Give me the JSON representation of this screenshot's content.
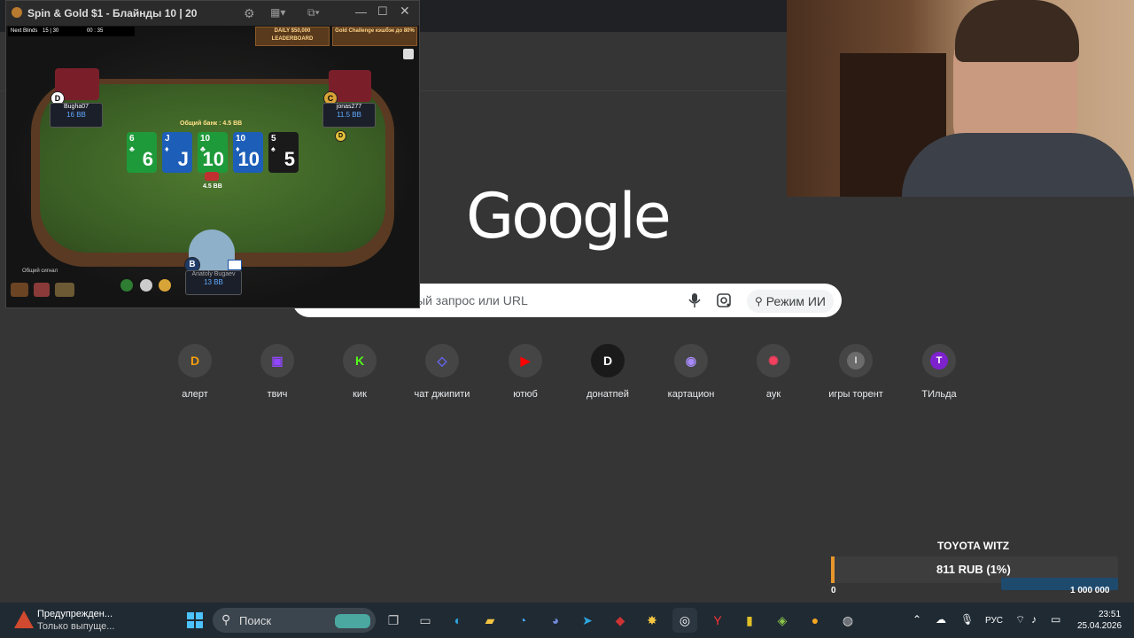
{
  "poker": {
    "window_title": "Spin & Gold $1 - Блайнды 10 | 20",
    "next_blinds_label": "Next Blinds",
    "next_blinds_value": "15 | 30",
    "timer": "00 : 35",
    "promo_left": "DAILY $50,000 LEADERBOARD",
    "promo_right": "Gold Challenge кэшбэк до 80%",
    "pot_label": "Общий банк : 4.5 BB",
    "pot_chips": "4.5 BB",
    "seat_left_name": "Bugha07",
    "seat_left_stack": "16 BB",
    "seat_right_name": "jonas277",
    "seat_right_stack": "11.5 BB",
    "seat_hero_name": "Anatoly Bugaev",
    "seat_hero_stack": "13 BB",
    "shared_signal": "Общий сигнал",
    "board_cards": [
      {
        "rank": "6",
        "suit": "♣",
        "color": "#1f9a3a"
      },
      {
        "rank": "J",
        "suit": "♦",
        "color": "#1d5fb8"
      },
      {
        "rank": "10",
        "suit": "♣",
        "color": "#1f9a3a"
      },
      {
        "rank": "10",
        "suit": "♦",
        "color": "#1d5fb8"
      },
      {
        "rank": "5",
        "suit": "♠",
        "color": "#1a1a1a"
      }
    ]
  },
  "google": {
    "logo_text": "Google",
    "search_placeholder": "ый запрос или URL",
    "ai_mode_label": "Режим ИИ"
  },
  "shortcuts": [
    {
      "label": "алерт",
      "glyph": "D",
      "color": "#f59e0b"
    },
    {
      "label": "твич",
      "glyph": "▣",
      "color": "#9146ff"
    },
    {
      "label": "кик",
      "glyph": "K",
      "color": "#53fc18"
    },
    {
      "label": "чат джипити",
      "glyph": "◇",
      "color": "#6366f1"
    },
    {
      "label": "ютюб",
      "glyph": "▶",
      "color": "#ff0000"
    },
    {
      "label": "донатпей",
      "glyph": "D",
      "color": "#111111"
    },
    {
      "label": "картацион",
      "glyph": "◉",
      "color": "#7c3aed"
    },
    {
      "label": "аук",
      "glyph": "✺",
      "color": "#e11d48"
    },
    {
      "label": "игры торент",
      "glyph": "I",
      "color": "#6b6b6b"
    },
    {
      "label": "ТИльда",
      "glyph": "T",
      "color": "#7e22ce"
    }
  ],
  "donation": {
    "title": "TOYOTA WITZ",
    "amount": "811 RUB (1%)",
    "min": "0",
    "max": "1 000 000",
    "progress_fraction": 0.01
  },
  "taskbar": {
    "notification_title": "Предупрежден...",
    "notification_sub": "Только выпуще...",
    "search_label": "Поиск",
    "language": "РУС",
    "time": "23:51",
    "date": "25.04.2026"
  }
}
